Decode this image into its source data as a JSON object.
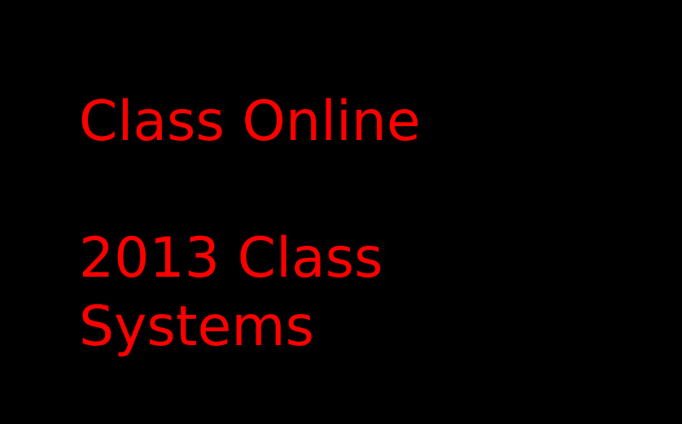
{
  "colors": {
    "background": "#000000",
    "text": "#ff0000"
  },
  "title": "Class Online",
  "subtitle_lines": [
    "2013 Class",
    "Systems"
  ]
}
